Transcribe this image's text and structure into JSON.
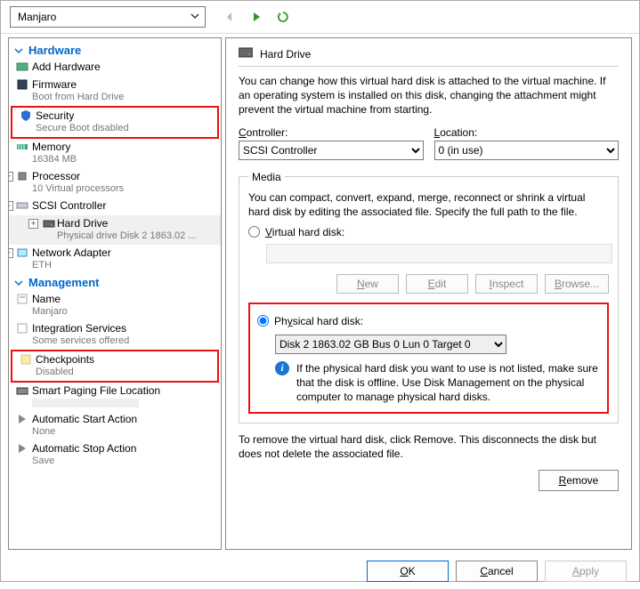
{
  "topbar": {
    "vm_name": "Manjaro"
  },
  "sidebar": {
    "groups": [
      {
        "title": "Hardware",
        "items": [
          {
            "label": "Add Hardware",
            "sub": "",
            "icon": "add-hw"
          },
          {
            "label": "Firmware",
            "sub": "Boot from Hard Drive",
            "icon": "firmware"
          },
          {
            "label": "Security",
            "sub": "Secure Boot disabled",
            "icon": "shield",
            "highlight": true
          },
          {
            "label": "Memory",
            "sub": "16384 MB",
            "icon": "memory"
          },
          {
            "label": "Processor",
            "sub": "10 Virtual processors",
            "icon": "cpu",
            "expander": "+"
          },
          {
            "label": "SCSI Controller",
            "sub": "",
            "icon": "scsi",
            "expander": "-"
          },
          {
            "label": "Hard Drive",
            "sub": "Physical drive Disk 2 1863.02 ...",
            "icon": "hdd",
            "indent": true,
            "expander": "+",
            "selected": true
          },
          {
            "label": "Network Adapter",
            "sub": "ETH",
            "icon": "nic",
            "expander": "+"
          }
        ]
      },
      {
        "title": "Management",
        "items": [
          {
            "label": "Name",
            "sub": "Manjaro",
            "icon": "name"
          },
          {
            "label": "Integration Services",
            "sub": "Some services offered",
            "icon": "integ"
          },
          {
            "label": "Checkpoints",
            "sub": "Disabled",
            "icon": "checkpoint",
            "highlight": true
          },
          {
            "label": "Smart Paging File Location",
            "sub": "",
            "icon": "paging"
          },
          {
            "label": "Automatic Start Action",
            "sub": "None",
            "icon": "autostart"
          },
          {
            "label": "Automatic Stop Action",
            "sub": "Save",
            "icon": "autostop"
          }
        ]
      }
    ]
  },
  "content": {
    "title": "Hard Drive",
    "intro": "You can change how this virtual hard disk is attached to the virtual machine. If an operating system is installed on this disk, changing the attachment might prevent the virtual machine from starting.",
    "controller_label": "Controller:",
    "controller_value": "SCSI Controller",
    "location_label": "Location:",
    "location_value": "0 (in use)",
    "media_legend": "Media",
    "media_text": "You can compact, convert, expand, merge, reconnect or shrink a virtual hard disk by editing the associated file. Specify the full path to the file.",
    "vhd_label": "Virtual hard disk:",
    "btn_new": "New",
    "btn_edit": "Edit",
    "btn_inspect": "Inspect",
    "btn_browse": "Browse...",
    "phys_label": "Physical hard disk:",
    "phys_value": "Disk 2 1863.02 GB Bus 0 Lun 0 Target 0",
    "phys_info": "If the physical hard disk you want to use is not listed, make sure that the disk is offline. Use Disk Management on the physical computer to manage physical hard disks.",
    "remove_text": "To remove the virtual hard disk, click Remove. This disconnects the disk but does not delete the associated file.",
    "btn_remove": "Remove"
  },
  "footer": {
    "ok": "OK",
    "cancel": "Cancel",
    "apply": "Apply"
  }
}
